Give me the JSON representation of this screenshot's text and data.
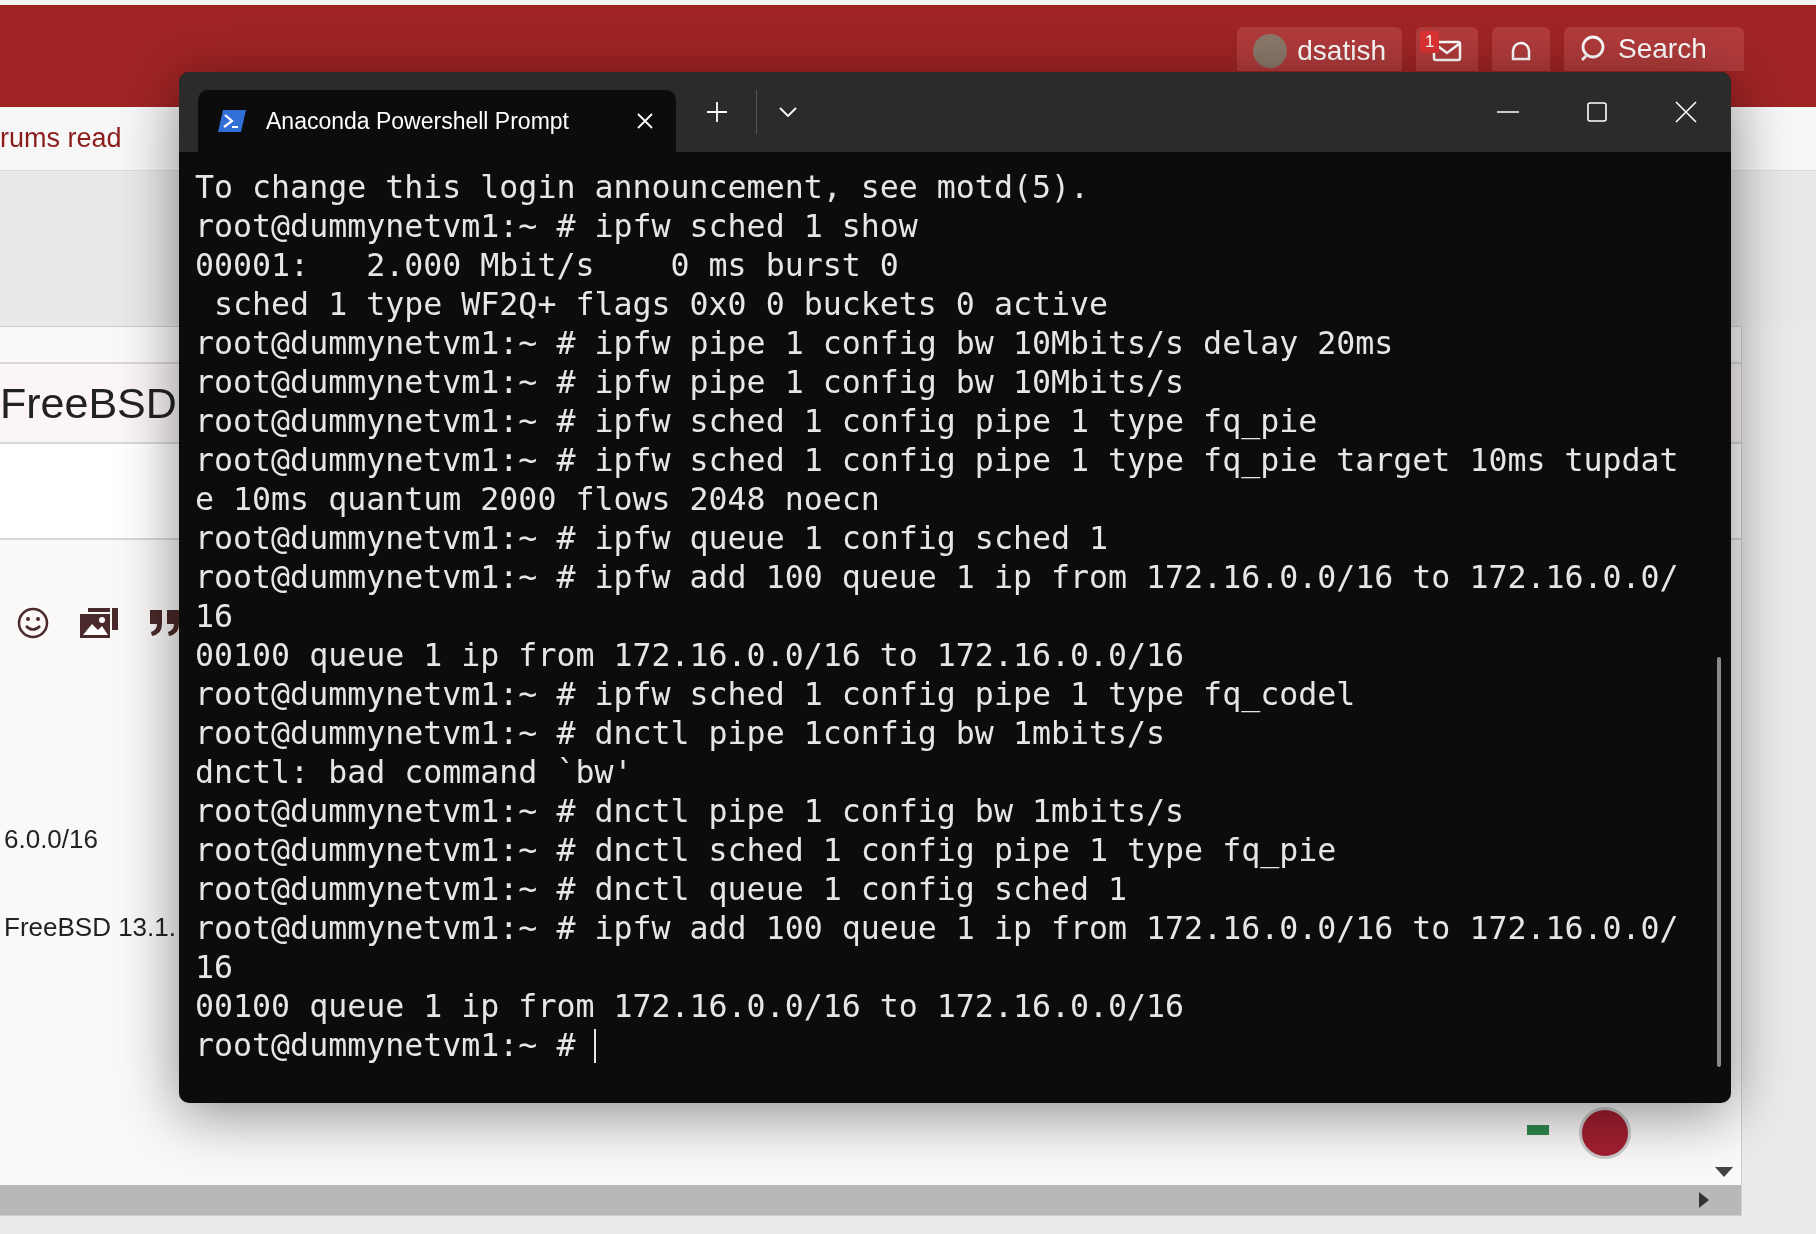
{
  "site": {
    "forum_link": "rums read",
    "user": {
      "name": "dsatish",
      "message_count": "1"
    },
    "search_label": "Search"
  },
  "post": {
    "title": "FreeBSD",
    "lines": [
      "6.0.0/16",
      "FreeBSD 13.1."
    ]
  },
  "terminal": {
    "tabs": [
      {
        "title": "Anaconda Powershell Prompt",
        "selected": true
      }
    ],
    "lines": [
      "To change this login announcement, see motd(5).",
      "root@dummynetvm1:~ # ipfw sched 1 show",
      "00001:   2.000 Mbit/s    0 ms burst 0",
      " sched 1 type WF2Q+ flags 0x0 0 buckets 0 active",
      "root@dummynetvm1:~ # ipfw pipe 1 config bw 10Mbits/s delay 20ms",
      "root@dummynetvm1:~ # ipfw pipe 1 config bw 10Mbits/s",
      "root@dummynetvm1:~ # ipfw sched 1 config pipe 1 type fq_pie",
      "root@dummynetvm1:~ # ipfw sched 1 config pipe 1 type fq_pie target 10ms tupdat",
      "e 10ms quantum 2000 flows 2048 noecn",
      "root@dummynetvm1:~ # ipfw queue 1 config sched 1",
      "root@dummynetvm1:~ # ipfw add 100 queue 1 ip from 172.16.0.0/16 to 172.16.0.0/",
      "16",
      "00100 queue 1 ip from 172.16.0.0/16 to 172.16.0.0/16",
      "root@dummynetvm1:~ # ipfw sched 1 config pipe 1 type fq_codel",
      "root@dummynetvm1:~ # dnctl pipe 1config bw 1mbits/s",
      "dnctl: bad command `bw'",
      "root@dummynetvm1:~ # dnctl pipe 1 config bw 1mbits/s",
      "root@dummynetvm1:~ # dnctl sched 1 config pipe 1 type fq_pie",
      "root@dummynetvm1:~ # dnctl queue 1 config sched 1",
      "root@dummynetvm1:~ # ipfw add 100 queue 1 ip from 172.16.0.0/16 to 172.16.0.0/",
      "16",
      "00100 queue 1 ip from 172.16.0.0/16 to 172.16.0.0/16"
    ],
    "prompt": "root@dummynetvm1:~ #"
  }
}
